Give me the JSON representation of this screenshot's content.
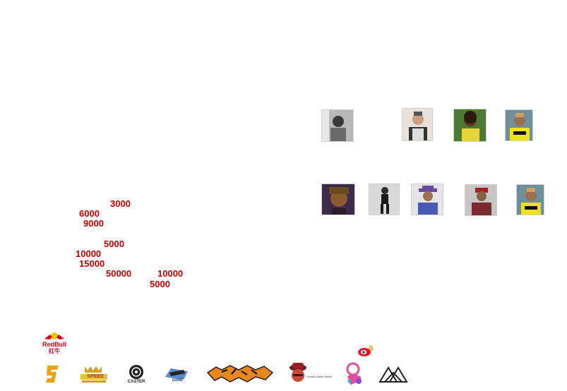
{
  "prizes": {
    "p1": "3000",
    "p2": "6000",
    "p3": "9000",
    "p4": "5000",
    "p5": "10000",
    "p6": "15000",
    "p7": "50000",
    "p8": "10000",
    "p9": "5000"
  },
  "colors": {
    "prize_red": "#c00000",
    "redbull_red": "#d0021b",
    "redbull_yellow": "#f5c400",
    "gold": "#d4a017",
    "orange": "#e8871e"
  },
  "logos": {
    "redbull_text": "RedBull",
    "redbull_cn": "红牛",
    "caster_text": "CASTER",
    "speed_text": "SPEED",
    "guns_text": "GUNS",
    "studio_text": "Groove's Dance Studio"
  },
  "icons": [
    "weibo-icon",
    "mountain-logo"
  ]
}
